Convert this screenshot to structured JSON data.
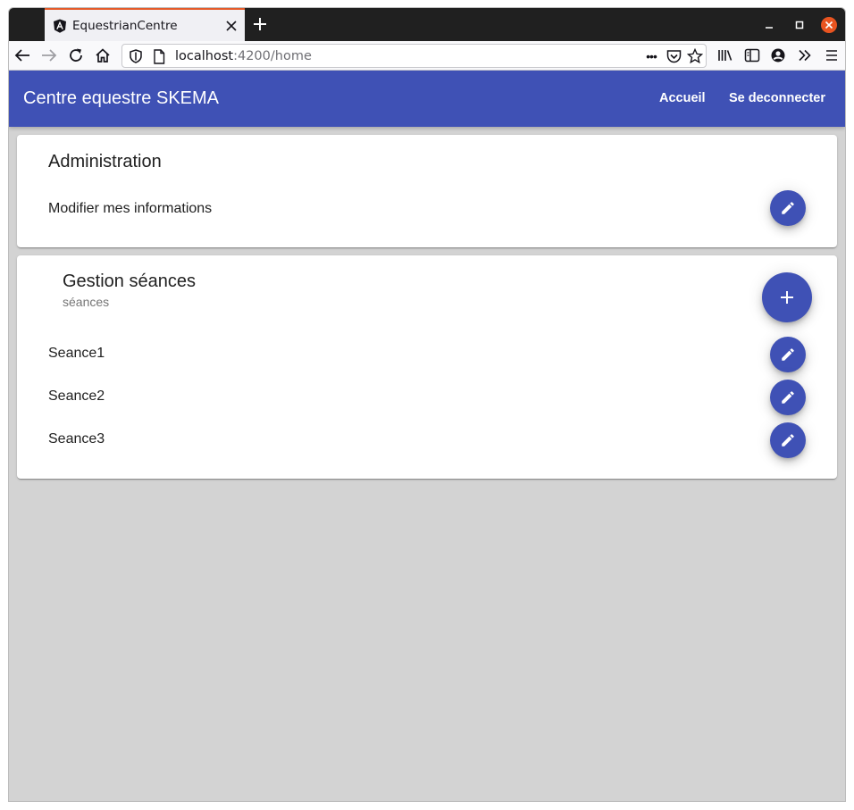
{
  "browser": {
    "tab_title": "EquestrianCentre",
    "url_host": "localhost",
    "url_rest": ":4200/home",
    "page_actions": "•••"
  },
  "app": {
    "title": "Centre equestre SKEMA",
    "nav": [
      {
        "label": "Accueil"
      },
      {
        "label": "Se deconnecter"
      }
    ]
  },
  "administration": {
    "title": "Administration",
    "item_label": "Modifier mes informations"
  },
  "sessions": {
    "title": "Gestion séances",
    "subtitle": "séances",
    "items": [
      {
        "label": "Seance1"
      },
      {
        "label": "Seance2"
      },
      {
        "label": "Seance3"
      }
    ]
  },
  "colors": {
    "primary": "#3f51b5",
    "page_background": "#d3d3d3",
    "tab_accent": "#e55b2a",
    "close_button": "#e95420"
  },
  "icons": {
    "edit": "pencil-icon",
    "add": "plus-icon"
  }
}
